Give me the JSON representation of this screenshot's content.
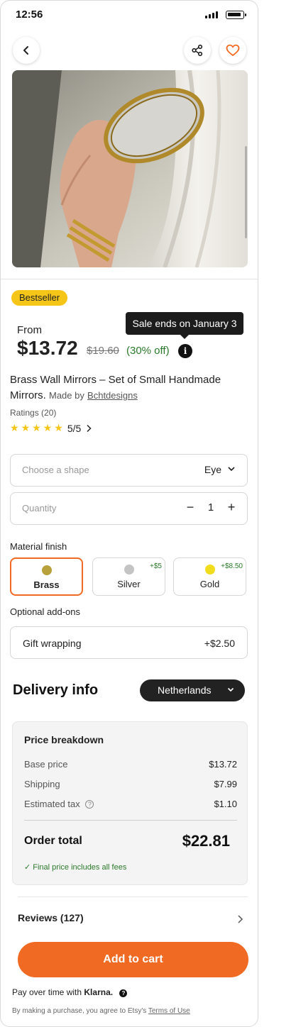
{
  "status_bar": {
    "time": "12:56"
  },
  "product": {
    "badge": "Bestseller",
    "tooltip": "Sale ends on January 3",
    "price_prefix": "From",
    "price": "$13.72",
    "original_price": "$19.60",
    "discount": "(30% off)",
    "title": "Brass Wall Mirrors – Set of Small Handmade Mirrors.",
    "made_by_label": "Made by",
    "shop_name": "Bchtdesigns",
    "ratings_label": "Ratings (20)",
    "rating_value": 5,
    "rating_text": "5/5"
  },
  "options": {
    "shape": {
      "placeholder": "Choose a shape",
      "value": "Eye"
    },
    "quantity": {
      "placeholder": "Quantity",
      "value": "1",
      "minus": "−",
      "plus": "+"
    }
  },
  "material": {
    "label": "Material finish",
    "items": [
      {
        "name": "Brass",
        "extra": "",
        "color": "#b8a13a",
        "selected": true
      },
      {
        "name": "Silver",
        "extra": "+$5",
        "color": "#c4c4c4",
        "selected": false
      },
      {
        "name": "Gold",
        "extra": "+$8.50",
        "color": "#f2dc1e",
        "selected": false
      }
    ]
  },
  "addons": {
    "label": "Optional add-ons",
    "gift_label": "Gift wrapping",
    "gift_price": "+$2.50"
  },
  "delivery": {
    "title": "Delivery info",
    "country": "Netherlands"
  },
  "breakdown": {
    "title": "Price breakdown",
    "rows": [
      {
        "label": "Base price",
        "value": "$13.72"
      },
      {
        "label": "Shipping",
        "value": "$7.99"
      },
      {
        "label": "Estimated tax",
        "value": "$1.10"
      }
    ],
    "help_glyph": "?",
    "total_label": "Order total",
    "total_value": "$22.81",
    "note": "✓ Final price includes all fees"
  },
  "reviews": {
    "label": "Reviews (127)"
  },
  "cart": {
    "label": "Add to cart"
  },
  "klarna": {
    "prefix": "Pay over time with",
    "brand": "Klarna.",
    "help_glyph": "?"
  },
  "terms": {
    "text": "By making a purchase, you agree to Etsy's",
    "link": "Terms of Use"
  },
  "colors": {
    "accent": "#f06a23",
    "badge": "#f5c518",
    "discount_green": "#2b7a2b",
    "dark_pill": "#222222"
  }
}
